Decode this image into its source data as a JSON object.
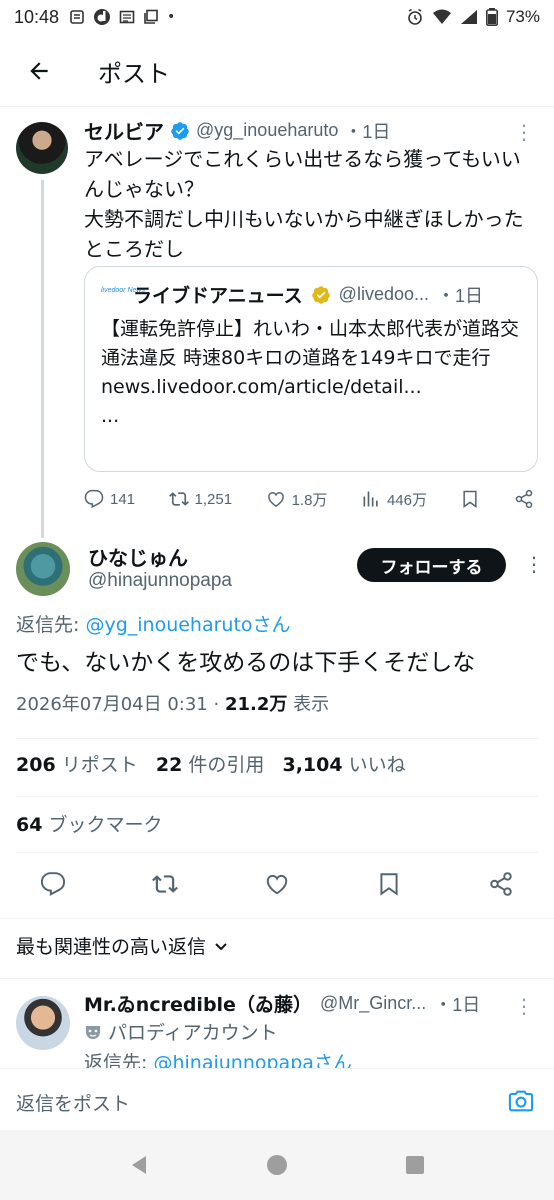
{
  "status_bar": {
    "time": "10:48",
    "battery": "73%"
  },
  "header": {
    "title": "ポスト"
  },
  "parent_tweet": {
    "name": "セルビア",
    "handle": "@yg_inoueharuto",
    "age": "・1日",
    "text_line1": "アベレージでこれくらい出せるなら獲ってもいいんじゃない？",
    "text_line2": "大勢不調だし中川もいないから中継ぎほしかったところだし",
    "quote": {
      "logo_text": "livedoor News",
      "name": "ライブドアニュース",
      "handle": "@livedoo...",
      "age": "・1日",
      "text": "【運転免許停止】れいわ・山本太郎代表が道路交通法違反 時速80キロの道路を149キロで走行",
      "link": "news.livedoor.com/article/detail...",
      "ellipsis": "..."
    },
    "actions": {
      "replies": "141",
      "reposts": "1,251",
      "likes": "1.8万",
      "views": "446万"
    }
  },
  "main_tweet": {
    "name": "ひなじゅん",
    "handle": "@hinajunnopapa",
    "follow_label": "フォローする",
    "reply_prefix": "返信先: ",
    "reply_handle": "@yg_inoueharutoさん",
    "text": "でも、ないかくを攻めるのは下手くそだしな",
    "datetime": "2026年07月04日 0:31 · ",
    "views_count": "21.2万",
    "views_label": " 表示",
    "reposts_count": "206",
    "reposts_label": " リポスト",
    "quotes_count": "22",
    "quotes_label": " 件の引用",
    "likes_count": "3,104",
    "likes_label": " いいね",
    "bookmarks_count": "64",
    "bookmarks_label": " ブックマーク"
  },
  "sort_label": "最も関連性の高い返信",
  "reply": {
    "name": "Mr.ゐncredible（ゐ藤）",
    "handle": "@Mr_Gincr...",
    "age": "・1日",
    "parody_label": "パロディアカウント",
    "reply_prefix": "返信先: ",
    "reply_handle": "@hinajunnopapaさん"
  },
  "composer": {
    "placeholder": "返信をポスト"
  },
  "colors": {
    "link": "#1d9bf0",
    "secondary_text": "#536471",
    "verified_blue": "#1d9bf0",
    "verified_gold": "#e2b719"
  }
}
